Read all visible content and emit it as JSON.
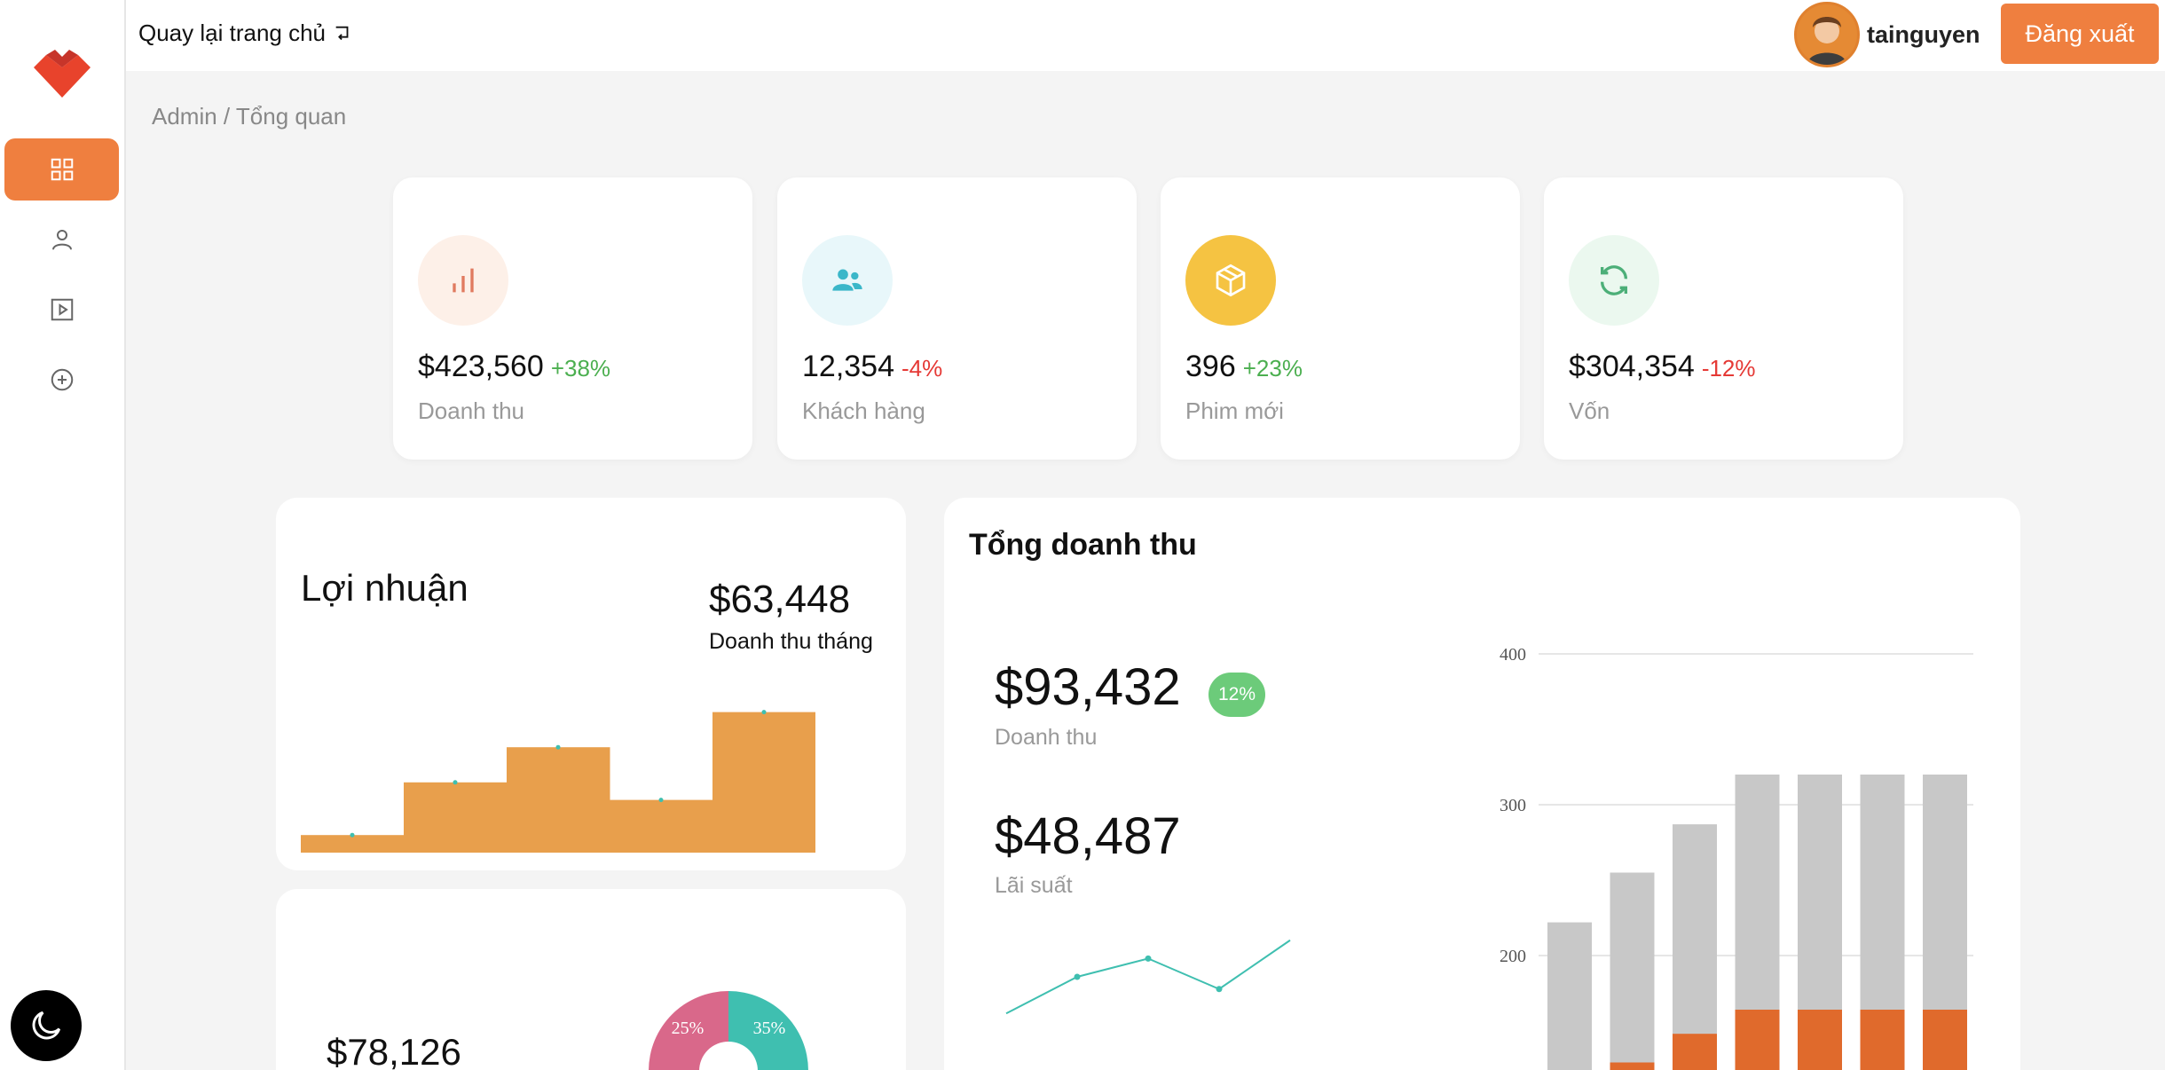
{
  "header": {
    "back_label": "Quay lại trang chủ",
    "username": "tainguyen",
    "logout_label": "Đăng xuất"
  },
  "breadcrumb": "Admin / Tổng quan",
  "sidebar": {
    "items": [
      {
        "icon": "dashboard-icon",
        "active": true
      },
      {
        "icon": "user-icon",
        "active": false
      },
      {
        "icon": "play-icon",
        "active": false
      },
      {
        "icon": "add-circle-icon",
        "active": false
      }
    ],
    "theme_icon": "moon-icon"
  },
  "stats": [
    {
      "value": "$423,560",
      "change": "+38%",
      "label": "Doanh thu",
      "icon": "bar-chart-icon",
      "trend": "up",
      "icon_bg": "#fdf0e8",
      "icon_color": "#e07a5f"
    },
    {
      "value": "12,354",
      "change": "-4%",
      "label": "Khách hàng",
      "icon": "users-icon",
      "trend": "down",
      "icon_bg": "#e8f7fa",
      "icon_color": "#3bb7c9"
    },
    {
      "value": "396",
      "change": "+23%",
      "label": "Phim mới",
      "icon": "box-icon",
      "trend": "up",
      "icon_bg": "#f5c342",
      "icon_color": "#ffffff"
    },
    {
      "value": "$304,354",
      "change": "-12%",
      "label": "Vốn",
      "icon": "refresh-icon",
      "trend": "down",
      "icon_bg": "#ebf8ef",
      "icon_color": "#4caf78"
    }
  ],
  "profit": {
    "title": "Lợi nhuận",
    "value": "$63,448",
    "subtitle": "Doanh thu tháng"
  },
  "donut_card": {
    "value": "$78,126"
  },
  "revenue": {
    "title": "Tổng doanh thu",
    "revenue_value": "$93,432",
    "revenue_badge": "12%",
    "revenue_label": "Doanh thu",
    "interest_value": "$48,487",
    "interest_label": "Lãi suất"
  },
  "colors": {
    "accent": "#ef7f3f",
    "step_fill": "#e89f4c",
    "teal": "#3fbfb0",
    "pink": "#d9688a",
    "bar_gray": "#c8c8c8",
    "bar_orange": "#e06a2c"
  },
  "chart_data": [
    {
      "type": "area",
      "title": "",
      "x": [
        1,
        2,
        3,
        4,
        5
      ],
      "values": [
        1,
        4,
        6,
        3,
        8
      ],
      "note_style": "step"
    },
    {
      "type": "pie",
      "slices": [
        {
          "label": "25%",
          "value": 25,
          "color": "#d9688a"
        },
        {
          "label": "35%",
          "value": 35,
          "color": "#3fbfb0"
        }
      ]
    },
    {
      "type": "line",
      "x": [
        1,
        2,
        3,
        4,
        5
      ],
      "values": [
        10,
        40,
        55,
        30,
        70
      ]
    },
    {
      "type": "bar",
      "y_ticks": [
        "400",
        "300",
        "200"
      ],
      "ylim": [
        0,
        400
      ],
      "series": [
        {
          "values": [
            222,
            255,
            287,
            320,
            320,
            320,
            320
          ]
        },
        {
          "values": [
            0,
            5,
            24,
            40,
            40,
            40,
            40
          ]
        }
      ]
    }
  ]
}
